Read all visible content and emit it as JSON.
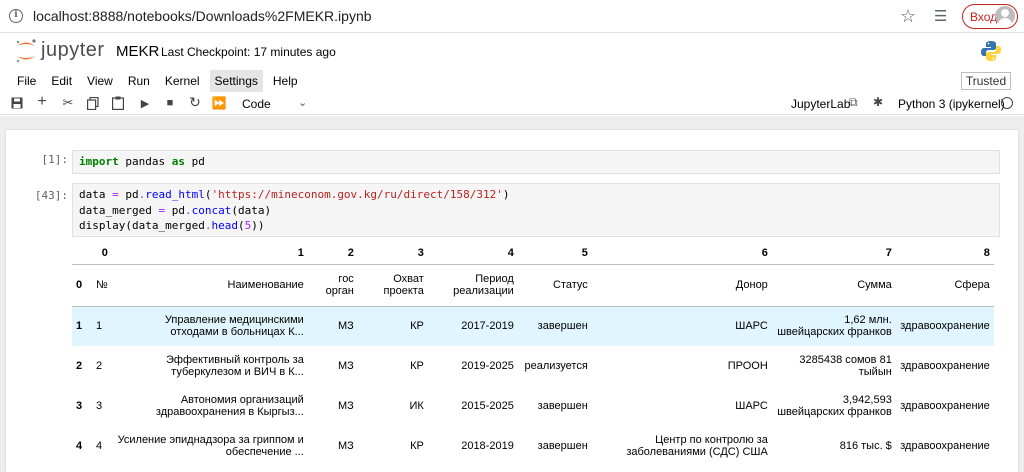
{
  "browser": {
    "url": "localhost:8888/notebooks/Downloads%2FMEKR.ipynb",
    "login_label": "Вход"
  },
  "header": {
    "logo_text": "jupyter",
    "notebook_name": "MEKR",
    "checkpoint": "Last Checkpoint: 17 minutes ago"
  },
  "menu": {
    "items": [
      "File",
      "Edit",
      "View",
      "Run",
      "Kernel",
      "Settings",
      "Help"
    ],
    "active": "Settings",
    "trusted_label": "Trusted"
  },
  "toolbar": {
    "cell_type": "Code",
    "jupyterlab_label": "JupyterLab",
    "kernel_name": "Python 3 (ipykernel)"
  },
  "cells": [
    {
      "prompt": "[1]:",
      "lines": [
        "import pandas as pd"
      ]
    },
    {
      "prompt": "[43]:",
      "lines": [
        "data = pd.read_html('https://mineconom.gov.kg/ru/direct/158/312')",
        "data_merged = pd.concat(data)",
        "display(data_merged.head(5))"
      ]
    }
  ],
  "table": {
    "col_index": [
      "",
      "0",
      "1",
      "2",
      "3",
      "4",
      "5",
      "6",
      "7",
      "8"
    ],
    "header_row": [
      "0",
      "№",
      "Наименование",
      "гос орган",
      "Охват проекта",
      "Период реализации",
      "Статус",
      "Донор",
      "Сумма",
      "Сфера"
    ],
    "rows": [
      [
        "1",
        "1",
        "Управление медицинскими отходами в больницах К...",
        "МЗ",
        "КР",
        "2017-2019",
        "завершен",
        "ШАРС",
        "1,62 млн. швейцарских франков",
        "здравоохранение"
      ],
      [
        "2",
        "2",
        "Эффективный контроль за туберкулезом и ВИЧ в К...",
        "МЗ",
        "КР",
        "2019-2025",
        "реализуется",
        "ПРООН",
        "3285438 сомов 81 тыйын",
        "здравоохранение"
      ],
      [
        "3",
        "3",
        "Автономия организаций здравоохранения в Кыргыз...",
        "МЗ",
        "ИК",
        "2015-2025",
        "завершен",
        "ШАРС",
        "3,942,593 швейцарских франков",
        "здравоохранение"
      ],
      [
        "4",
        "4",
        "Усиление эпиднадзора за гриппом и обеспечение ...",
        "МЗ",
        "КР",
        "2018-2019",
        "завершен",
        "Центр по контролю за заболеваниями (СДС) США",
        "816 тыс. $",
        "здравоохранение"
      ]
    ]
  }
}
